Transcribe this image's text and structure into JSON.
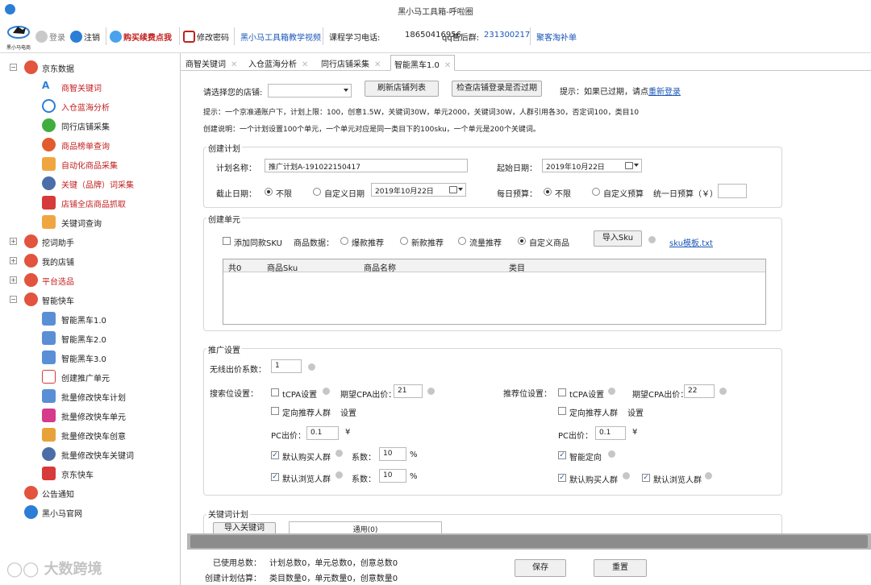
{
  "window": {
    "title": "黑小马工具箱-呼啦圈"
  },
  "brand": {
    "text": "黑小马电商"
  },
  "toolbar": {
    "login": "登录",
    "logout": "注销",
    "buy": "购买续费点我",
    "change_pwd": "修改密码",
    "video": "黑小马工具箱教学视频",
    "phone_label": "课程学习电话:",
    "phone": "18650416956",
    "qq_label": "qq售后群:",
    "qq": "231300217",
    "promo": "聚客淘补单"
  },
  "tree": {
    "jd": "京东数据",
    "jd_items": [
      "商智关键词",
      "入仓蓝海分析",
      "同行店铺采集",
      "商品榜单查询",
      "自动化商品采集",
      "关键（品牌）词采集",
      "店铺全店商品抓取",
      "关键词查询"
    ],
    "wajue": "挖词助手",
    "mystore": "我的店铺",
    "platform": "平台选品",
    "kuaiche": "智能快车",
    "kuaiche_items": [
      "智能黑车1.0",
      "智能黑车2.0",
      "智能黑车3.0",
      "创建推广单元",
      "批量修改快车计划",
      "批量修改快车单元",
      "批量修改快车创意",
      "批量修改快车关键词",
      "京东快车"
    ],
    "notice": "公告通知",
    "official": "黑小马官网"
  },
  "tabs": [
    "商智关键词",
    "入仓蓝海分析",
    "同行店铺采集",
    "智能黑车1.0"
  ],
  "store": {
    "label": "请选择您的店铺:",
    "refresh": "刷新店铺列表",
    "check": "检查店铺登录是否过期",
    "hint_prefix": "提示：如果已过期，请点",
    "relogin": "重新登录"
  },
  "tips": {
    "line1": "提示：一个京准通账户下，计划上限：100，创意1.5W，关键词30W，单元2000，关键词30W，人群引用各30，否定词100，类目10",
    "line2": "创建说明：一个计划设置100个单元，一个单元对应是同一类目下的100sku，一个单元是200个关键词。"
  },
  "plan": {
    "legend": "创建计划",
    "name_label": "计划名称：",
    "name_value": "推广计划A-191022150417",
    "start_label": "起始日期：",
    "start_value": "2019年10月22日",
    "end_label": "截止日期：",
    "end_unlimited": "不限",
    "end_custom": "自定义日期",
    "end_value": "2019年10月22日",
    "budget_label": "每日预算：",
    "budget_unlimited": "不限",
    "budget_custom": "自定义预算",
    "unified_label": "统一日预算（￥）"
  },
  "unit": {
    "legend": "创建单元",
    "same_sku": "添加同款SKU",
    "data_label": "商品数据：",
    "opt1": "爆款推荐",
    "opt2": "新款推荐",
    "opt3": "流量推荐",
    "opt4": "自定义商品",
    "import_btn": "导入Sku",
    "template": "sku模板.txt",
    "grid_headers": [
      "共0",
      "商品Sku",
      "商品名称",
      "类目"
    ]
  },
  "promo": {
    "legend": "推广设置",
    "wireless_label": "无线出价系数：",
    "wireless_value": "1",
    "search_label": "搜索位设置：",
    "tcpa": "tCPA设置",
    "cpa_label": "期望CPA出价：",
    "search_cpa": "21",
    "target_crowd": "定向推荐人群",
    "setting": "设置",
    "pc_label": "PC出价：",
    "pc_value": "0.1",
    "yuan": "¥",
    "default_buy": "默认购买人群",
    "coef_label": "系数：",
    "coef1": "10",
    "percent": "%",
    "default_browse": "默认浏览人群",
    "coef2": "10",
    "rec_label": "推荐位设置：",
    "rec_cpa": "22",
    "rec_pc": "0.1",
    "smart_target": "智能定向",
    "rec_default_buy": "默认购买人群",
    "rec_default_browse": "默认浏览人群"
  },
  "keyword": {
    "legend": "关键词计划",
    "import_btn": "导入关键词",
    "common": "通用(0)"
  },
  "footer": {
    "used_label": "已使用总数：",
    "used_value": "计划总数0，单元总数0，创意总数0",
    "est_label": "创建计划估算：",
    "est_value": "类目数量0，单元数量0，创意数量0",
    "save": "保存",
    "reset": "重置"
  },
  "watermark": {
    "text": "大数跨境"
  },
  "colors": {
    "accent": "#1a56b8",
    "danger": "#c21f1f",
    "tree_icon": "#e2543d"
  }
}
